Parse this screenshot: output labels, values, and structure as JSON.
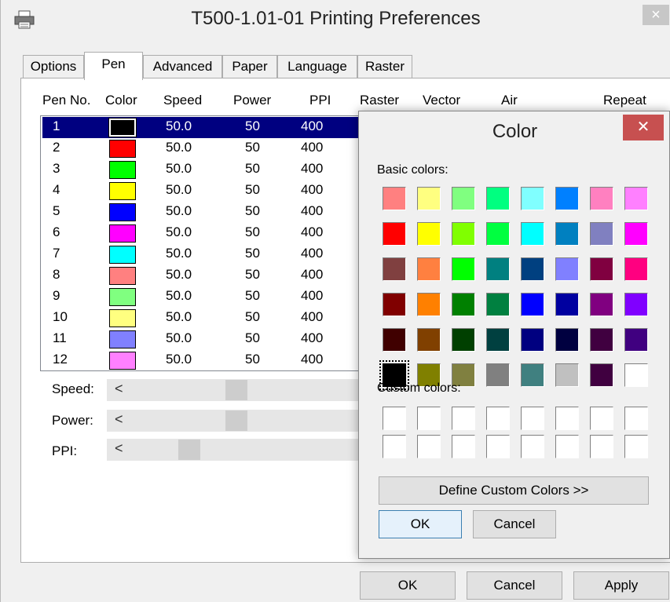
{
  "window": {
    "title": "T500-1.01-01 Printing Preferences",
    "close_glyph": "×",
    "icon": "printer-icon"
  },
  "tabs": [
    "Options",
    "Pen",
    "Advanced",
    "Paper",
    "Language",
    "Raster"
  ],
  "active_tab": "Pen",
  "columns": [
    "Pen No.",
    "Color",
    "Speed",
    "Power",
    "PPI",
    "Raster",
    "Vector",
    "Air",
    "Repeat"
  ],
  "pens": [
    {
      "no": "1",
      "color": "#000000",
      "speed": "50.0",
      "power": "50",
      "ppi": "400"
    },
    {
      "no": "2",
      "color": "#ff0000",
      "speed": "50.0",
      "power": "50",
      "ppi": "400"
    },
    {
      "no": "3",
      "color": "#00ff00",
      "speed": "50.0",
      "power": "50",
      "ppi": "400"
    },
    {
      "no": "4",
      "color": "#ffff00",
      "speed": "50.0",
      "power": "50",
      "ppi": "400"
    },
    {
      "no": "5",
      "color": "#0000ff",
      "speed": "50.0",
      "power": "50",
      "ppi": "400"
    },
    {
      "no": "6",
      "color": "#ff00ff",
      "speed": "50.0",
      "power": "50",
      "ppi": "400"
    },
    {
      "no": "7",
      "color": "#00ffff",
      "speed": "50.0",
      "power": "50",
      "ppi": "400"
    },
    {
      "no": "8",
      "color": "#ff8080",
      "speed": "50.0",
      "power": "50",
      "ppi": "400"
    },
    {
      "no": "9",
      "color": "#80ff80",
      "speed": "50.0",
      "power": "50",
      "ppi": "400"
    },
    {
      "no": "10",
      "color": "#ffff80",
      "speed": "50.0",
      "power": "50",
      "ppi": "400"
    },
    {
      "no": "11",
      "color": "#8080ff",
      "speed": "50.0",
      "power": "50",
      "ppi": "400"
    },
    {
      "no": "12",
      "color": "#ff80ff",
      "speed": "50.0",
      "power": "50",
      "ppi": "400"
    }
  ],
  "selected_pen": "1",
  "sliders": [
    {
      "label": "Speed:",
      "arrow": "<",
      "position": 0.5
    },
    {
      "label": "Power:",
      "arrow": "<",
      "position": 0.5
    },
    {
      "label": "PPI:",
      "arrow": "<",
      "position": 0.3
    }
  ],
  "buttons": {
    "ok": "OK",
    "cancel": "Cancel",
    "apply": "Apply"
  },
  "color_dialog": {
    "title": "Color",
    "close_glyph": "✕",
    "basic_label": "Basic colors:",
    "custom_label": "Custom colors:",
    "basic_colors": [
      [
        "#ff8080",
        "#ffff80",
        "#80ff80",
        "#00ff80",
        "#80ffff",
        "#0080ff",
        "#ff80c0",
        "#ff80ff"
      ],
      [
        "#ff0000",
        "#ffff00",
        "#80ff00",
        "#00ff40",
        "#00ffff",
        "#0080c0",
        "#8080c0",
        "#ff00ff"
      ],
      [
        "#804040",
        "#ff8040",
        "#00ff00",
        "#008080",
        "#004080",
        "#8080ff",
        "#800040",
        "#ff0080"
      ],
      [
        "#800000",
        "#ff8000",
        "#008000",
        "#008040",
        "#0000ff",
        "#0000a0",
        "#800080",
        "#8000ff"
      ],
      [
        "#400000",
        "#804000",
        "#004000",
        "#004040",
        "#000080",
        "#000040",
        "#400040",
        "#400080"
      ],
      [
        "#000000",
        "#808000",
        "#808040",
        "#808080",
        "#408080",
        "#c0c0c0",
        "#400040",
        "#ffffff"
      ]
    ],
    "selected_color": "#000000",
    "custom_rows": 2,
    "custom_cols": 8,
    "define_label": "Define Custom Colors >>",
    "ok_label": "OK",
    "cancel_label": "Cancel"
  }
}
